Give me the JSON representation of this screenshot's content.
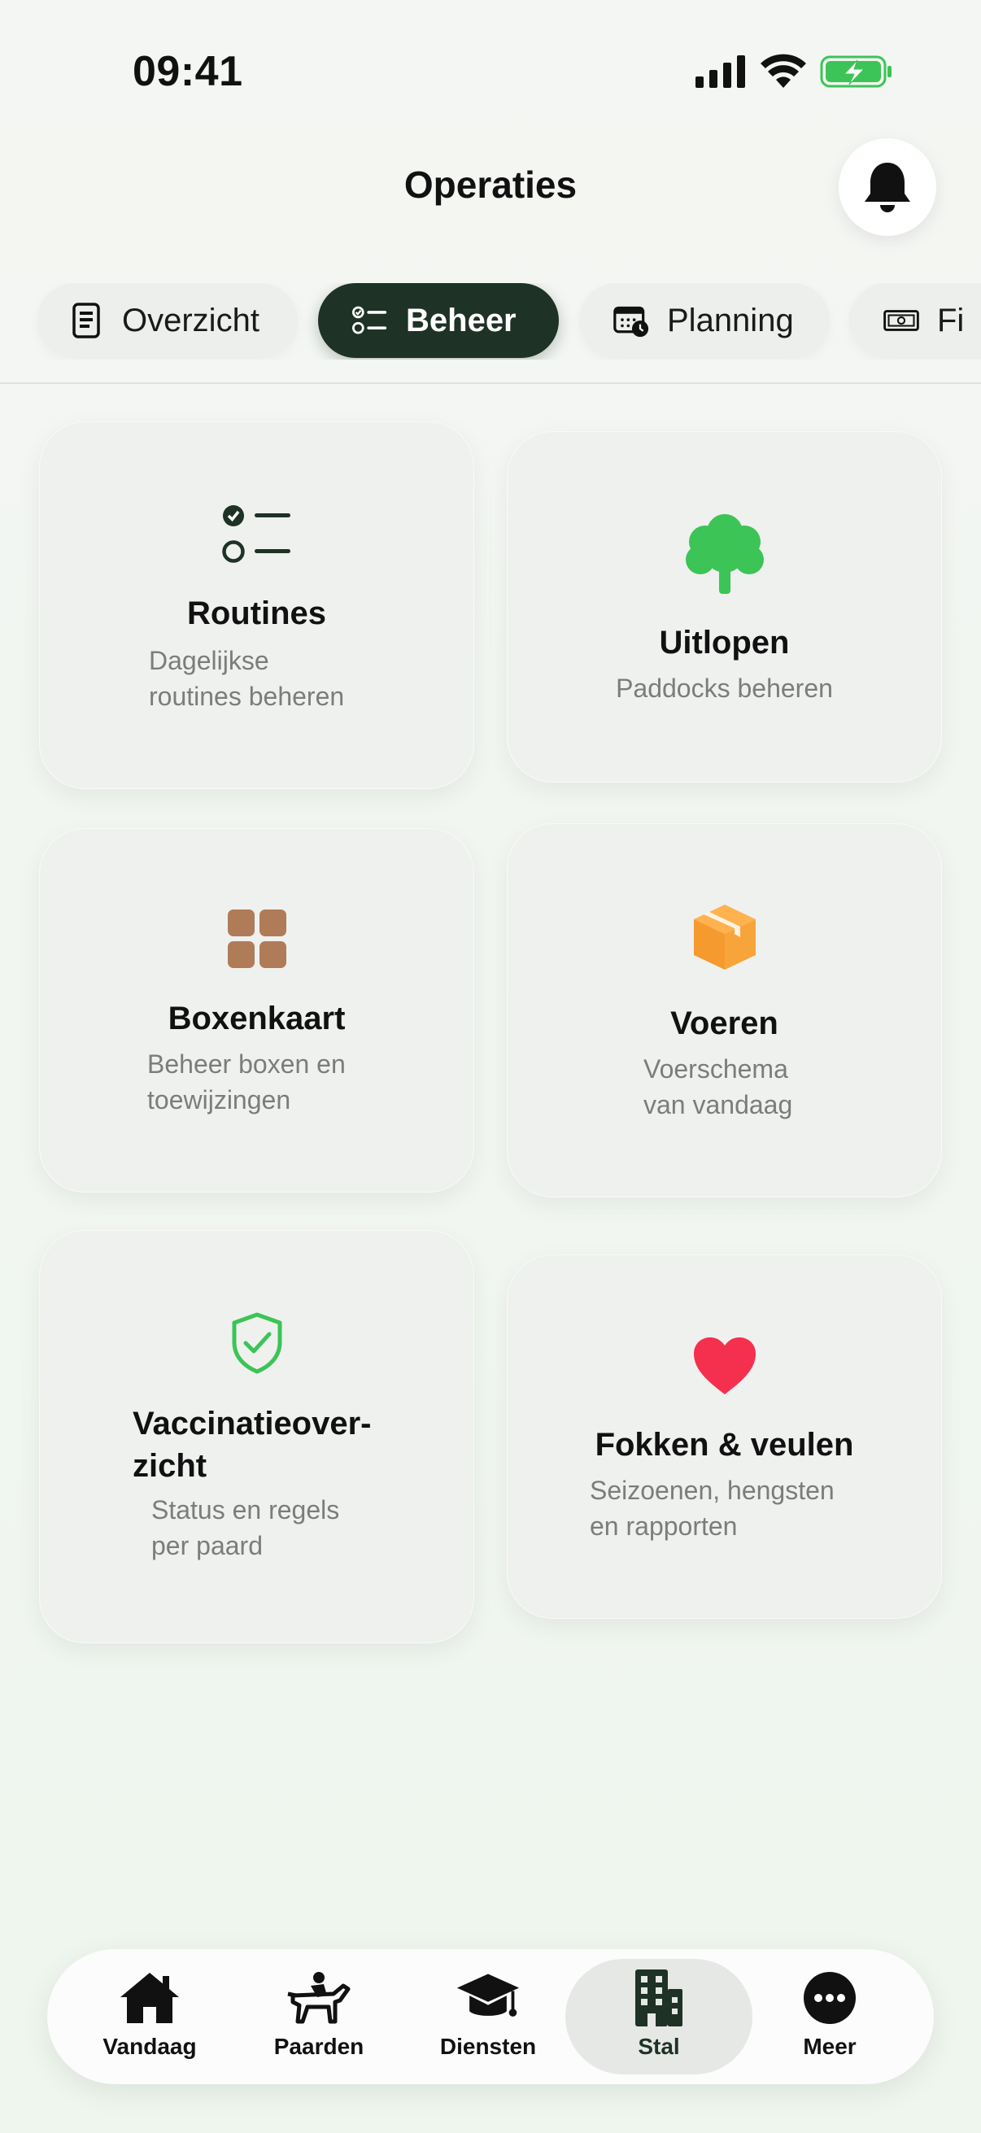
{
  "status_bar": {
    "time": "09:41"
  },
  "header": {
    "title": "Operaties"
  },
  "tabs": [
    {
      "label": "Overzicht",
      "icon": "document-icon",
      "active": false
    },
    {
      "label": "Beheer",
      "icon": "checklist-icon",
      "active": true
    },
    {
      "label": "Planning",
      "icon": "calendar-clock-icon",
      "active": false
    },
    {
      "label": "Fi",
      "icon": "banknote-icon",
      "active": false
    }
  ],
  "cards": [
    {
      "title": "Routines",
      "subtitle_line1": "Dagelijkse",
      "subtitle_line2": "routines beheren",
      "icon": "checklist-icon",
      "icon_color": "#1e3226"
    },
    {
      "title": "Uitlopen",
      "subtitle_line1": "Paddocks beheren",
      "subtitle_line2": "",
      "icon": "tree-icon",
      "icon_color": "#3cc456"
    },
    {
      "title": "Boxenkaart",
      "subtitle_line1": "Beheer boxen en",
      "subtitle_line2": "toewijzingen",
      "icon": "grid-icon",
      "icon_color": "#b07c58"
    },
    {
      "title": "Voeren",
      "subtitle_line1": "Voerschema",
      "subtitle_line2": "van vandaag",
      "icon": "box-icon",
      "icon_color": "#f59a2f"
    },
    {
      "title_line1": "Vaccinatieover-",
      "title_line2": "zicht",
      "subtitle_line1": "Status en regels",
      "subtitle_line2": "per paard",
      "icon": "shield-check-icon",
      "icon_color": "#3cc456"
    },
    {
      "title": "Fokken & veulen",
      "subtitle_line1": "Seizoenen, hengsten",
      "subtitle_line2": "en rapporten",
      "icon": "heart-icon",
      "icon_color": "#f5304f"
    }
  ],
  "bottom_nav": [
    {
      "label": "Vandaag",
      "icon": "house-icon",
      "active": false
    },
    {
      "label": "Paarden",
      "icon": "horse-rider-icon",
      "active": false
    },
    {
      "label": "Diensten",
      "icon": "graduation-cap-icon",
      "active": false
    },
    {
      "label": "Stal",
      "icon": "building-icon",
      "active": true
    },
    {
      "label": "Meer",
      "icon": "more-icon",
      "active": false
    }
  ],
  "colors": {
    "accent_dark": "#1e3226",
    "battery_green": "#3cc456"
  }
}
